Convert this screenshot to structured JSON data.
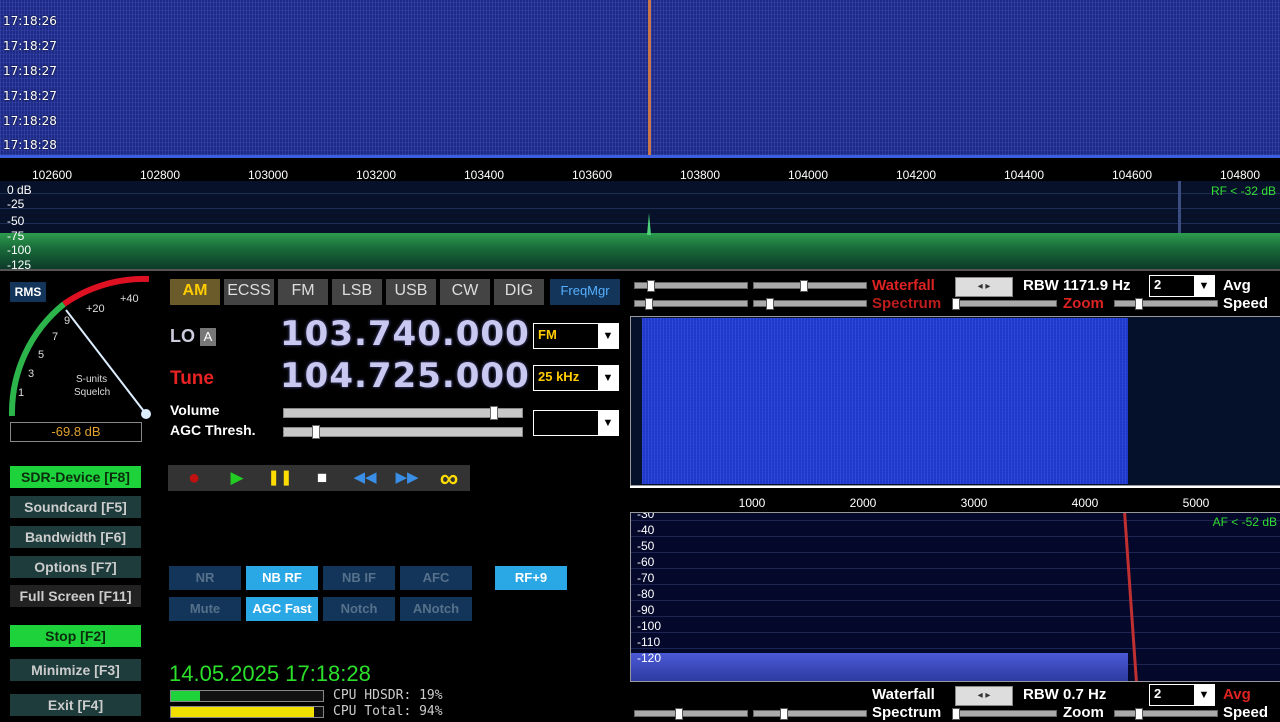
{
  "waterfall": {
    "timestamps": [
      "17:18:26",
      "17:18:27",
      "17:18:27",
      "17:18:27",
      "17:18:28",
      "17:18:28"
    ],
    "freq_ticks": [
      "102600",
      "102800",
      "103000",
      "103200",
      "103400",
      "103600",
      "103800",
      "104000",
      "104200",
      "104400",
      "104600",
      "104800"
    ]
  },
  "spectrum": {
    "db_labels": [
      "0 dB",
      "-25",
      "-50",
      "-75",
      "-100",
      "-125"
    ],
    "rf_label": "RF < -32 dB"
  },
  "meter": {
    "rms_label": "RMS",
    "scale_labels": [
      "1",
      "3",
      "5",
      "7",
      "9",
      "+20",
      "+40"
    ],
    "caption_line1": "S-units",
    "caption_line2": "Squelch",
    "value": "-69.8 dB"
  },
  "modes": {
    "items": [
      "AM",
      "ECSS",
      "FM",
      "LSB",
      "USB",
      "CW",
      "DIG"
    ],
    "freqmgr": "FreqMgr"
  },
  "lo": {
    "label": "LO",
    "badge": "A",
    "freq": "103.740.000",
    "mode_select": "FM"
  },
  "tune": {
    "label": "Tune",
    "freq": "104.725.000",
    "step_select": "25 kHz"
  },
  "volume": {
    "label": "Volume",
    "agc_label": "AGC Thresh.",
    "agc_select": ""
  },
  "side_buttons": {
    "sdr_device": "SDR-Device [F8]",
    "soundcard": "Soundcard [F5]",
    "bandwidth": "Bandwidth [F6]",
    "options": "Options [F7]",
    "fullscreen": "Full Screen [F11]",
    "stop": "Stop [F2]",
    "minimize": "Minimize [F3]",
    "exit": "Exit [F4]"
  },
  "transport": {
    "record": "●",
    "play": "▶",
    "pause": "❚❚",
    "stop": "■",
    "rewind": "◀◀",
    "forward": "▶▶",
    "loop": "∞"
  },
  "dsp": {
    "nr": "NR",
    "nb_rf": "NB RF",
    "nb_if": "NB IF",
    "afc": "AFC",
    "rf9": "RF+9",
    "mute": "Mute",
    "agc_fast": "AGC Fast",
    "notch": "Notch",
    "anotch": "ANotch"
  },
  "status": {
    "datetime": "14.05.2025 17:18:28",
    "cpu_hdsdr": "CPU HDSDR: 19%",
    "cpu_total": "CPU Total: 94%",
    "cpu_hdsdr_level": 0.19,
    "cpu_total_level": 0.94
  },
  "top_controls": {
    "waterfall": "Waterfall",
    "spectrum": "Spectrum",
    "rbw": "RBW 1171.9 Hz",
    "zoom": "Zoom",
    "avg_select": "2",
    "avg": "Avg",
    "speed": "Speed"
  },
  "af": {
    "scale_ticks": [
      "1000",
      "2000",
      "3000",
      "4000",
      "5000"
    ],
    "db_labels": [
      "-30",
      "-40",
      "-50",
      "-60",
      "-70",
      "-80",
      "-90",
      "-100",
      "-110",
      "-120"
    ],
    "af_label": "AF < -52 dB"
  },
  "bottom_controls": {
    "waterfall": "Waterfall",
    "spectrum": "Spectrum",
    "rbw": "RBW  0.7 Hz",
    "zoom": "Zoom",
    "avg_select": "2",
    "avg": "Avg",
    "speed": "Speed"
  },
  "colors": {
    "accent_green": "#1ed23c",
    "active_blue": "#2aa8e6",
    "freq_text": "#c8c8f0",
    "red_label": "#dd2222"
  }
}
